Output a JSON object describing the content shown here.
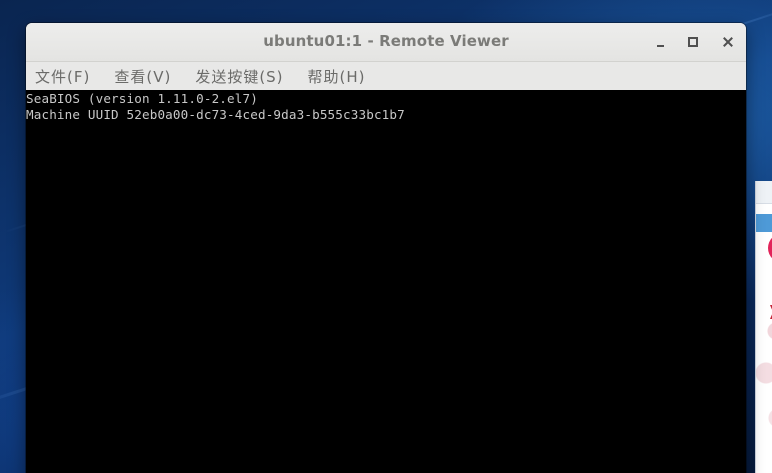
{
  "window": {
    "title": "ubuntu01:1 - Remote Viewer",
    "controls": {
      "minimize_icon": "minimize-icon",
      "maximize_icon": "maximize-icon",
      "close_icon": "close-icon"
    }
  },
  "menu": [
    {
      "label": "文件(F)"
    },
    {
      "label": "查看(V)"
    },
    {
      "label": "发送按键(S)"
    },
    {
      "label": "帮助(H)"
    }
  ],
  "console": {
    "lines": [
      "SeaBIOS (version 1.11.0-2.el7)",
      "Machine UUID 52eb0a00-dc73-4ced-9da3-b555c33bc1b7"
    ]
  },
  "colors": {
    "console_background": "#000000",
    "console_text": "#c8c8c8",
    "title_text": "#7b7b78",
    "desktop_background": "#0f3a7a"
  }
}
